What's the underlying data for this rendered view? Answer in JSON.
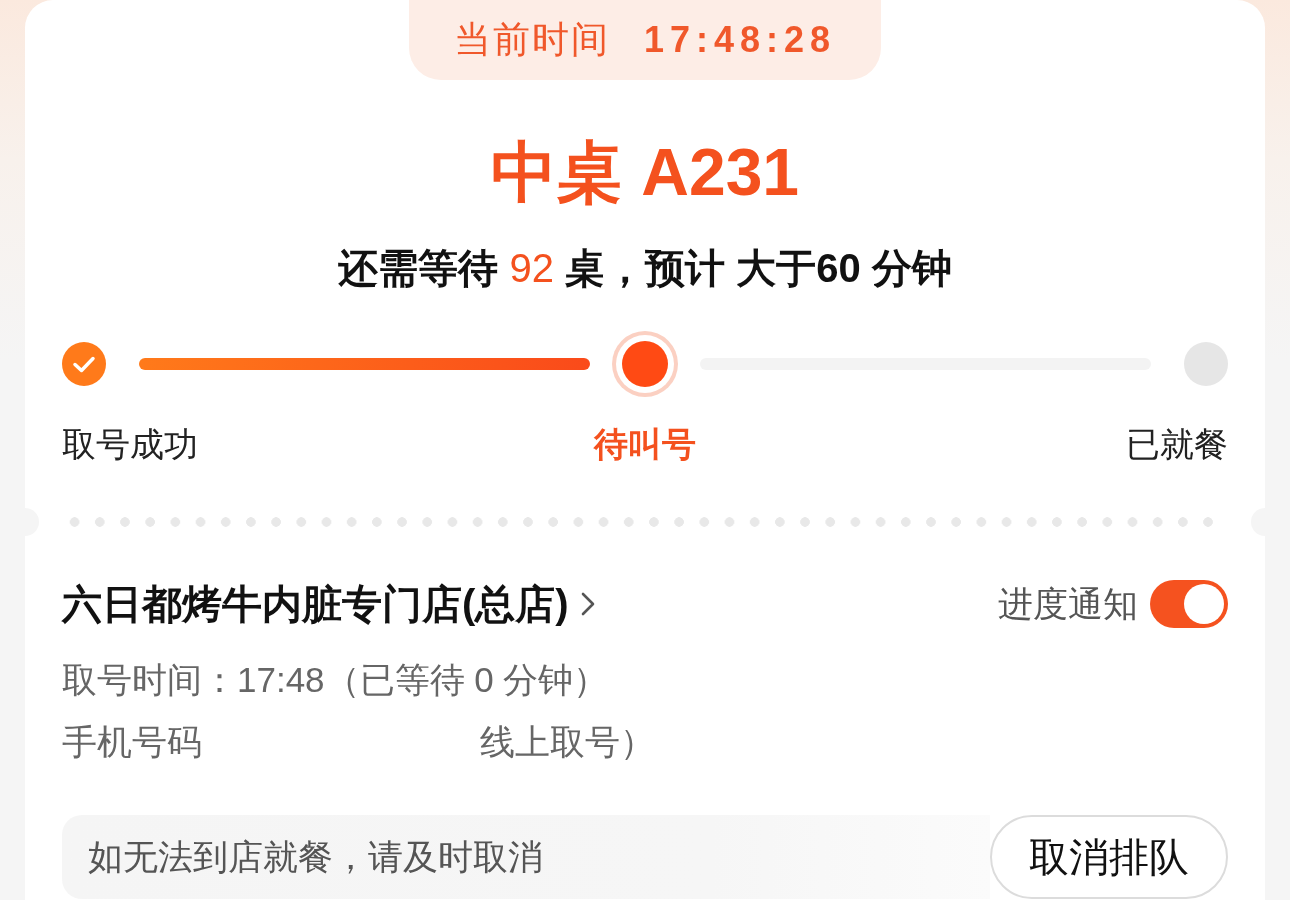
{
  "clock": {
    "label": "当前时间",
    "time": "17:48:28"
  },
  "ticket": {
    "number": "中桌 A231",
    "wait_prefix": "还需等待",
    "tables_ahead": "92",
    "wait_suffix": "桌，预计 大于60 分钟"
  },
  "steps": [
    {
      "label": "取号成功",
      "done": true,
      "selected": false
    },
    {
      "label": "待叫号",
      "done": false,
      "selected": true
    },
    {
      "label": "已就餐",
      "done": false,
      "selected": false
    }
  ],
  "store": {
    "name": "六日都烤牛内脏专门店(总店)",
    "notify": {
      "label": "进度通知",
      "on": true
    },
    "queue_time": "取号时间：17:48（已等待 0 分钟）",
    "phone_label": "手机号码",
    "phone_source": "线上取号）"
  },
  "notice": {
    "text": "如无法到店就餐，请及时取消",
    "cancel_button": "取消排队"
  }
}
